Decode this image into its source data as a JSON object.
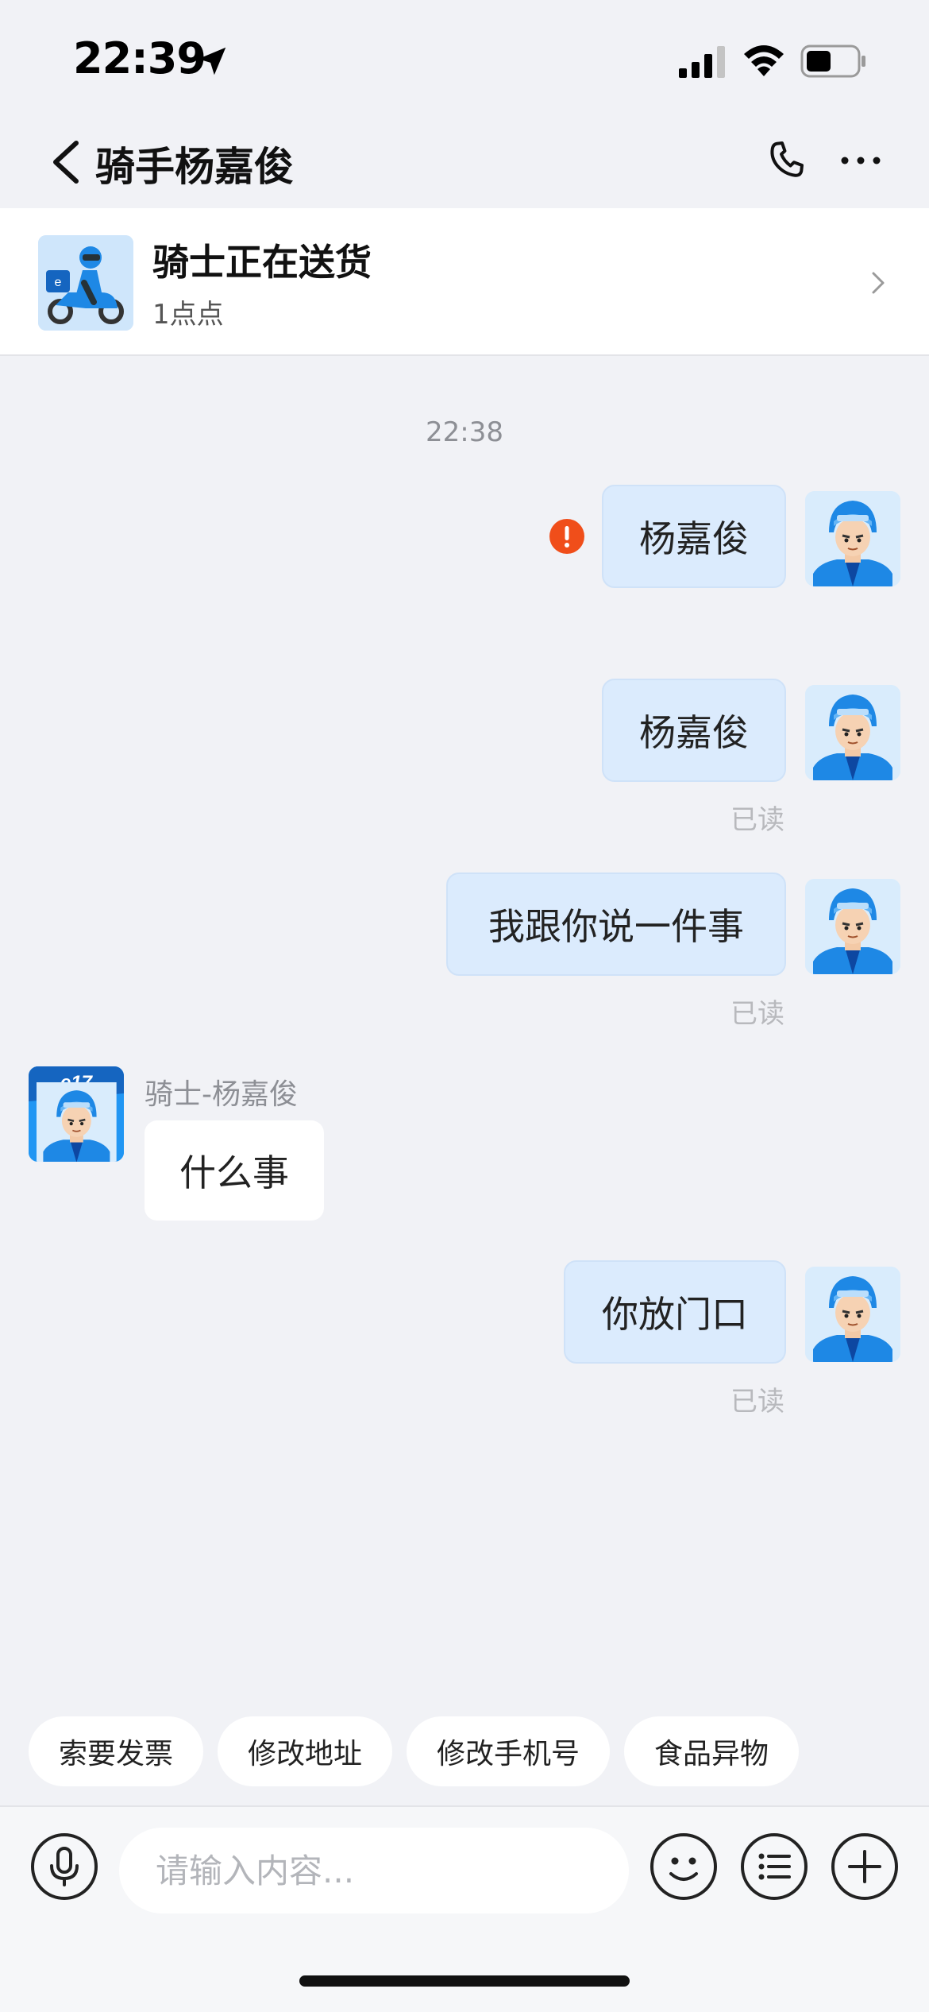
{
  "status_bar": {
    "time": "22:39"
  },
  "nav": {
    "title": "骑手杨嘉俊"
  },
  "order_card": {
    "title": "骑士正在送货",
    "subtitle": "1点点"
  },
  "chat": {
    "timestamp": "22:38",
    "messages": [
      {
        "side": "out",
        "text": "杨嘉俊",
        "status": "error"
      },
      {
        "side": "out",
        "text": "杨嘉俊",
        "read": "已读"
      },
      {
        "side": "out",
        "text": "我跟你说一件事",
        "read": "已读"
      },
      {
        "side": "in",
        "sender": "骑士-杨嘉俊",
        "text": "什么事"
      },
      {
        "side": "out",
        "text": "你放门口",
        "read": "已读"
      }
    ]
  },
  "quick_replies": [
    "索要发票",
    "修改地址",
    "修改手机号",
    "食品异物"
  ],
  "input": {
    "placeholder": "请输入内容..."
  },
  "colors": {
    "background": "#f1f2f6",
    "outgoing_bubble": "#dbebfd",
    "incoming_bubble": "#ffffff",
    "error": "#f04e1a",
    "accent": "#1e88e5"
  },
  "icons": [
    "location-arrow-icon",
    "signal-icon",
    "wifi-icon",
    "battery-icon",
    "back-chevron-icon",
    "phone-icon",
    "more-icon",
    "chevron-right-icon",
    "error-icon",
    "microphone-icon",
    "emoji-icon",
    "list-icon",
    "plus-icon"
  ]
}
